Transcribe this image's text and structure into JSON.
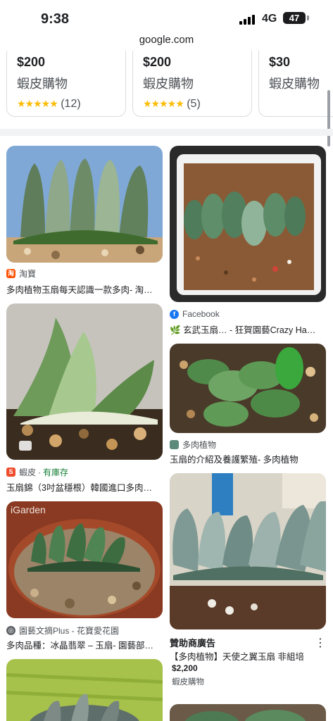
{
  "status_bar": {
    "time": "9:38",
    "network": "4G",
    "battery": "47"
  },
  "url": "google.com",
  "shopping_cards": [
    {
      "price": "$200",
      "seller": "蝦皮購物",
      "stars": "★★★★★",
      "reviews": "(12)"
    },
    {
      "price": "$200",
      "seller": "蝦皮購物",
      "stars": "★★★★★",
      "reviews": "(5)"
    },
    {
      "price": "$30",
      "seller": "蝦皮購物"
    }
  ],
  "results": {
    "r1": {
      "source": "淘寶",
      "caption": "多肉植物玉扇每天認識一款多肉- 淘…"
    },
    "r2": {
      "source": "Facebook",
      "caption": "🌿 玄武玉扇… - 狂賀園藝Crazy Ha…"
    },
    "r3": {
      "source": "蝦皮",
      "stock": "有庫存",
      "caption": "玉扇錦（3吋盆穩根）韓國進口多肉…"
    },
    "r4": {
      "source": "多肉植物",
      "caption": "玉扇的介紹及養護繁殖- 多肉植物"
    },
    "r5": {
      "watermark": "iGarden",
      "source": "園藝文摘Plus - 花寶愛花園",
      "caption": "多肉品種：冰晶翡翠 – 玉扇- 園藝部…"
    },
    "r6": {
      "sponsored": "贊助商廣告",
      "caption": "【多肉植物】天使之翼玉扇 非組培",
      "price": "$2,200",
      "seller": "蝦皮購物",
      "menu": "⋮"
    }
  },
  "colors": {
    "star": "#fbbc04",
    "in_stock": "#188038",
    "facebook": "#1877f2",
    "taobao": "#ff5000",
    "shopee": "#ee4d2d"
  }
}
